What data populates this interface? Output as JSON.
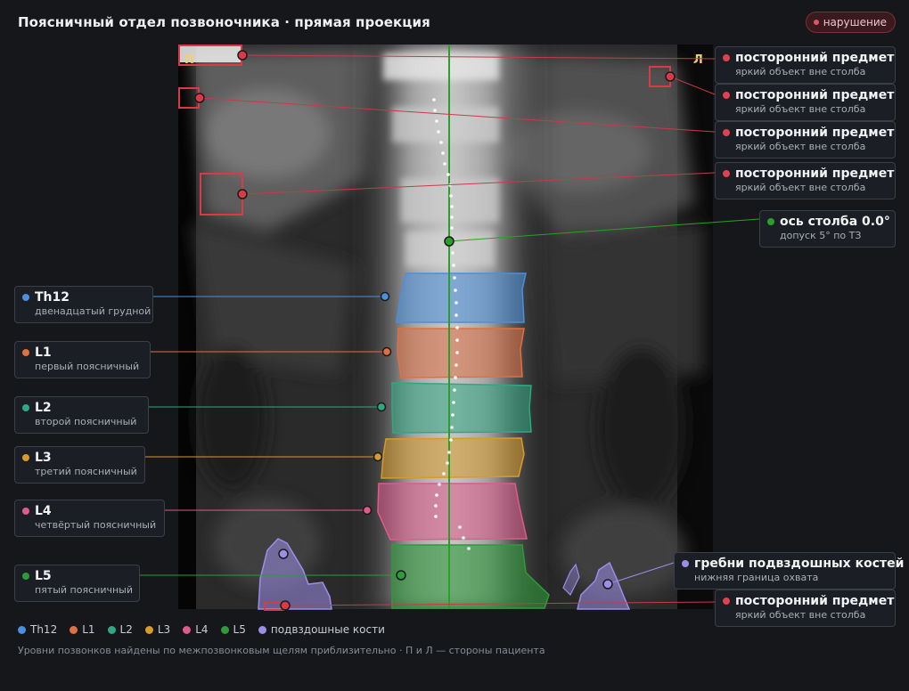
{
  "header": {
    "title": "Поясничный отдел позвоночника · прямая проекция",
    "status_badge": "нарушение"
  },
  "image": {
    "side_right_marker": "П",
    "side_left_marker": "Л"
  },
  "colors": {
    "Th12": "#4a8fe0",
    "L1": "#e07040",
    "L2": "#2fa882",
    "L3": "#d89a2a",
    "L4": "#e05a8a",
    "L5": "#2f9a3a",
    "iliac": "#9c8ee8",
    "foreign": "#e04050",
    "axis": "#2aa02a"
  },
  "vertebrae": [
    {
      "id": "Th12",
      "label": "Th12",
      "desc": "двенадцатый грудной"
    },
    {
      "id": "L1",
      "label": "L1",
      "desc": "первый поясничный"
    },
    {
      "id": "L2",
      "label": "L2",
      "desc": "второй поясничный"
    },
    {
      "id": "L3",
      "label": "L3",
      "desc": "третий поясничный"
    },
    {
      "id": "L4",
      "label": "L4",
      "desc": "четвёртый поясничный"
    },
    {
      "id": "L5",
      "label": "L5",
      "desc": "пятый поясничный"
    }
  ],
  "foreign_objects": [
    {
      "label": "посторонний предмет",
      "desc": "яркий объект вне столба"
    },
    {
      "label": "посторонний предмет",
      "desc": "яркий объект вне столба"
    },
    {
      "label": "посторонний предмет",
      "desc": "яркий объект вне столба"
    },
    {
      "label": "посторонний предмет",
      "desc": "яркий объект вне столба"
    },
    {
      "label": "посторонний предмет",
      "desc": "яркий объект вне столба"
    }
  ],
  "axis": {
    "label": "ось столба 0.0°",
    "desc": "допуск 5° по ТЗ"
  },
  "iliac": {
    "label": "гребни подвздошных костей",
    "desc": "нижняя граница охвата"
  },
  "legend": [
    {
      "key": "Th12",
      "label": "Th12"
    },
    {
      "key": "L1",
      "label": "L1"
    },
    {
      "key": "L2",
      "label": "L2"
    },
    {
      "key": "L3",
      "label": "L3"
    },
    {
      "key": "L4",
      "label": "L4"
    },
    {
      "key": "L5",
      "label": "L5"
    },
    {
      "key": "iliac",
      "label": "подвздошные кости"
    }
  ],
  "footnote": "Уровни позвонков найдены по межпозвонковым щелям приблизительно · П и Л — стороны пациента"
}
